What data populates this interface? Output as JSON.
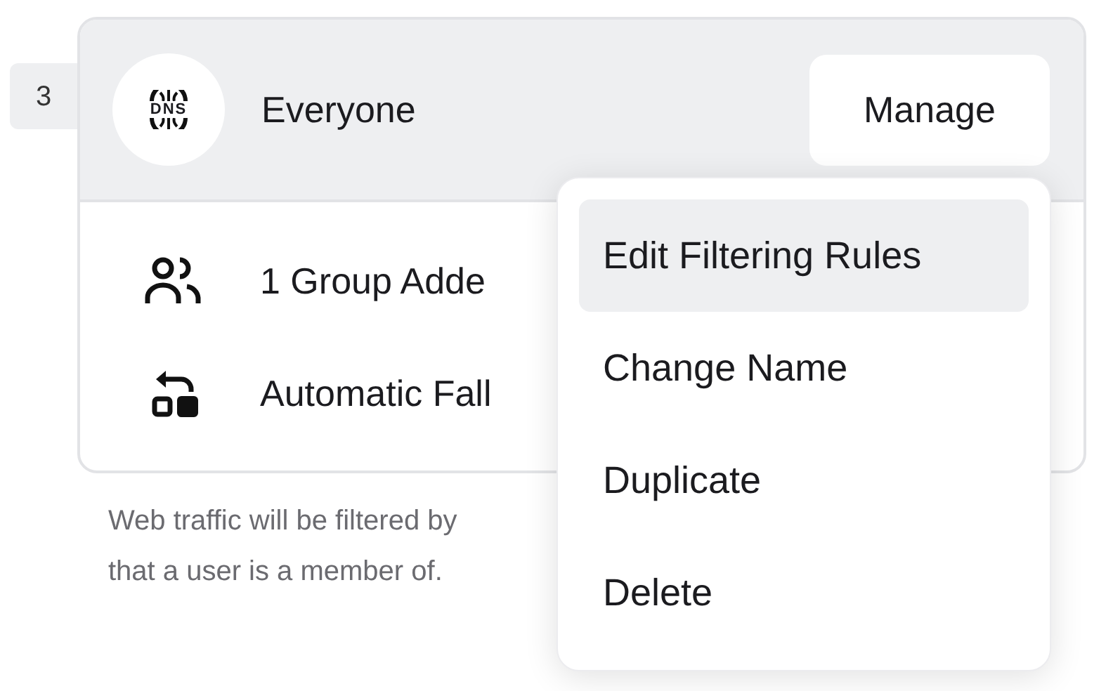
{
  "row_number": "3",
  "policy": {
    "logo_text": "DNS",
    "name": "Everyone",
    "manage_button": "Manage"
  },
  "details": [
    {
      "kind": "groups",
      "text": "1 Group Adde"
    },
    {
      "kind": "fallback",
      "text": "Automatic Fall"
    }
  ],
  "note": [
    "Web traffic will be filtered by",
    "that a user is a member of."
  ],
  "menu": [
    {
      "label": "Edit Filtering Rules",
      "selected": true
    },
    {
      "label": "Change Name",
      "selected": false
    },
    {
      "label": "Duplicate",
      "selected": false
    },
    {
      "label": "Delete",
      "selected": false
    }
  ]
}
